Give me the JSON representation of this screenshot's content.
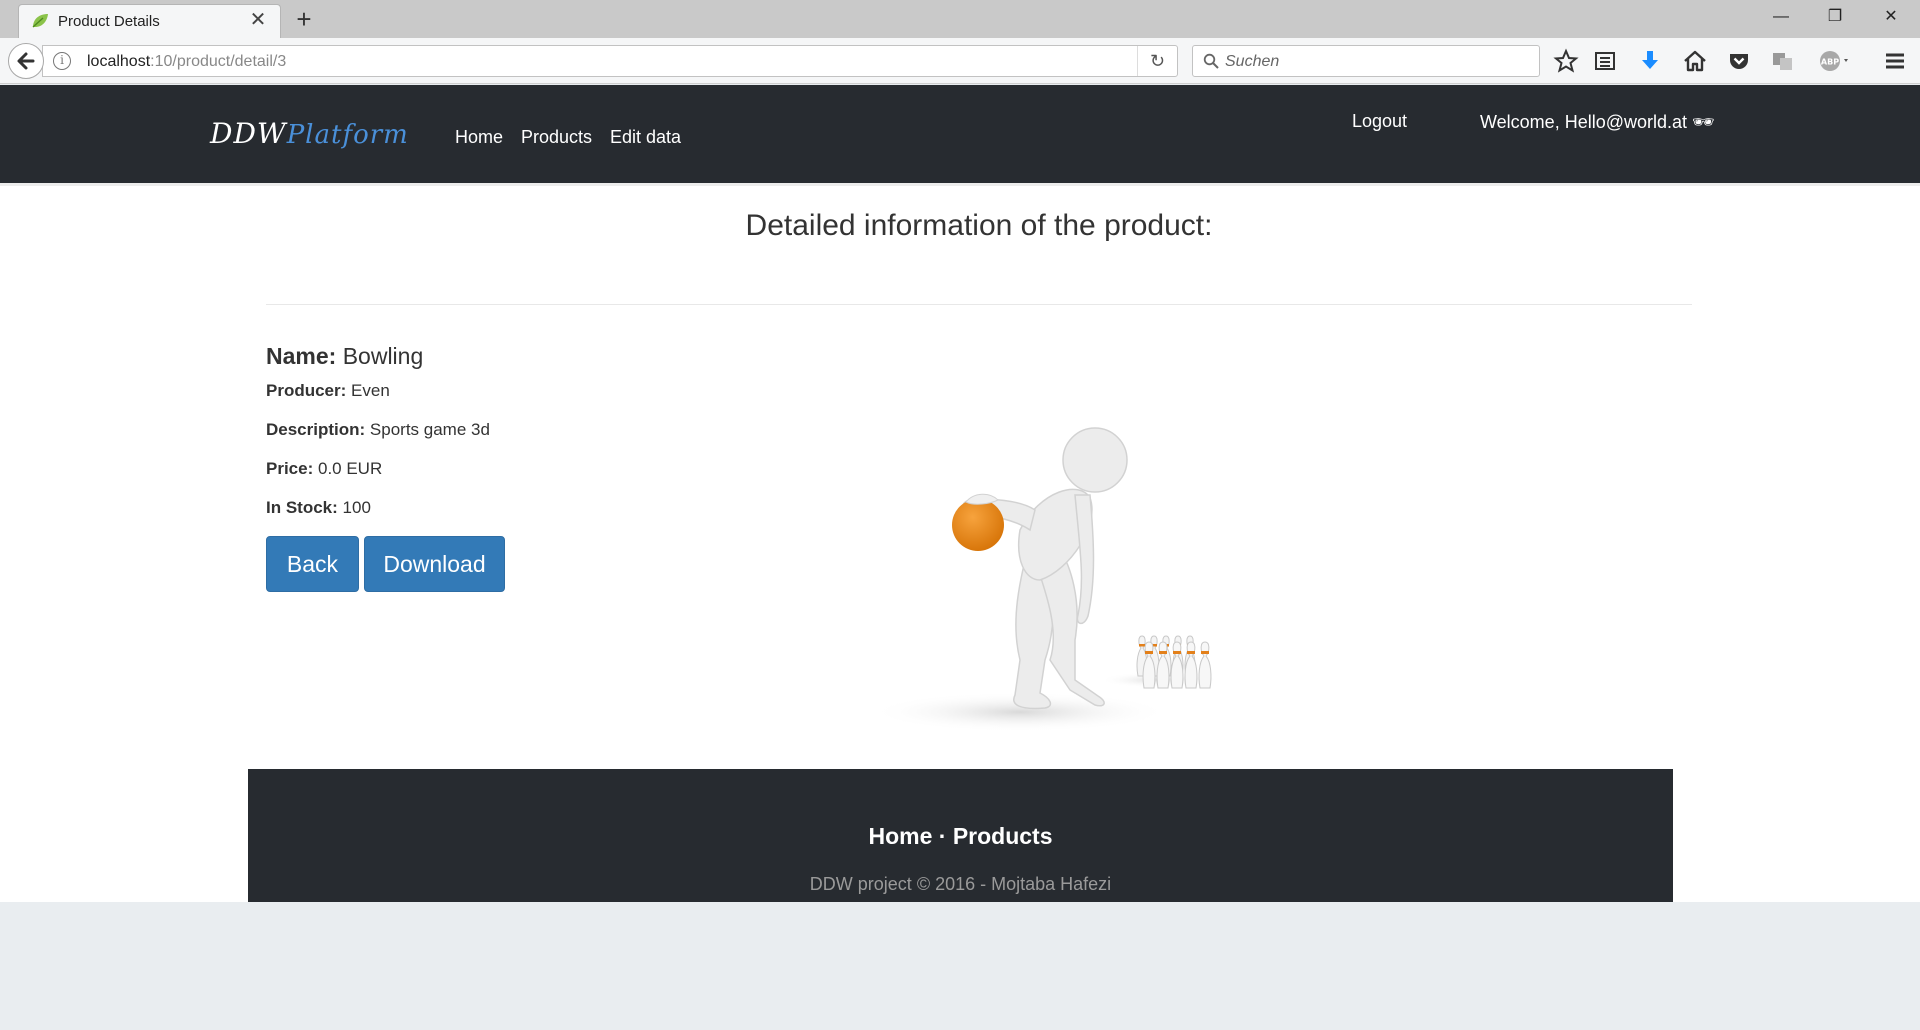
{
  "browser": {
    "tab_title": "Product Details",
    "url_host": "localhost",
    "url_path": ":10/product/detail/3",
    "search_placeholder": "Suchen"
  },
  "site": {
    "brand_main": "DDW",
    "brand_accent": "Platform",
    "nav": [
      "Home",
      "Products",
      "Edit data"
    ],
    "logout": "Logout",
    "welcome": "Welcome, Hello@world.at 🕶"
  },
  "product": {
    "heading": "Detailed information of the product:",
    "name_label": "Name:",
    "name": "Bowling",
    "producer_label": "Producer:",
    "producer": "Even",
    "description_label": "Description:",
    "description": "Sports game 3d",
    "price_label": "Price:",
    "price": "0.0 EUR",
    "stock_label": "In Stock:",
    "stock": "100",
    "back_label": "Back",
    "download_label": "Download"
  },
  "footer": {
    "links": "Home · Products",
    "copyright": "DDW project © 2016 - Mojtaba Hafezi"
  },
  "colors": {
    "navbar_bg": "#272b30",
    "primary_button": "#337ab7",
    "brand_accent": "#4a90d9"
  }
}
